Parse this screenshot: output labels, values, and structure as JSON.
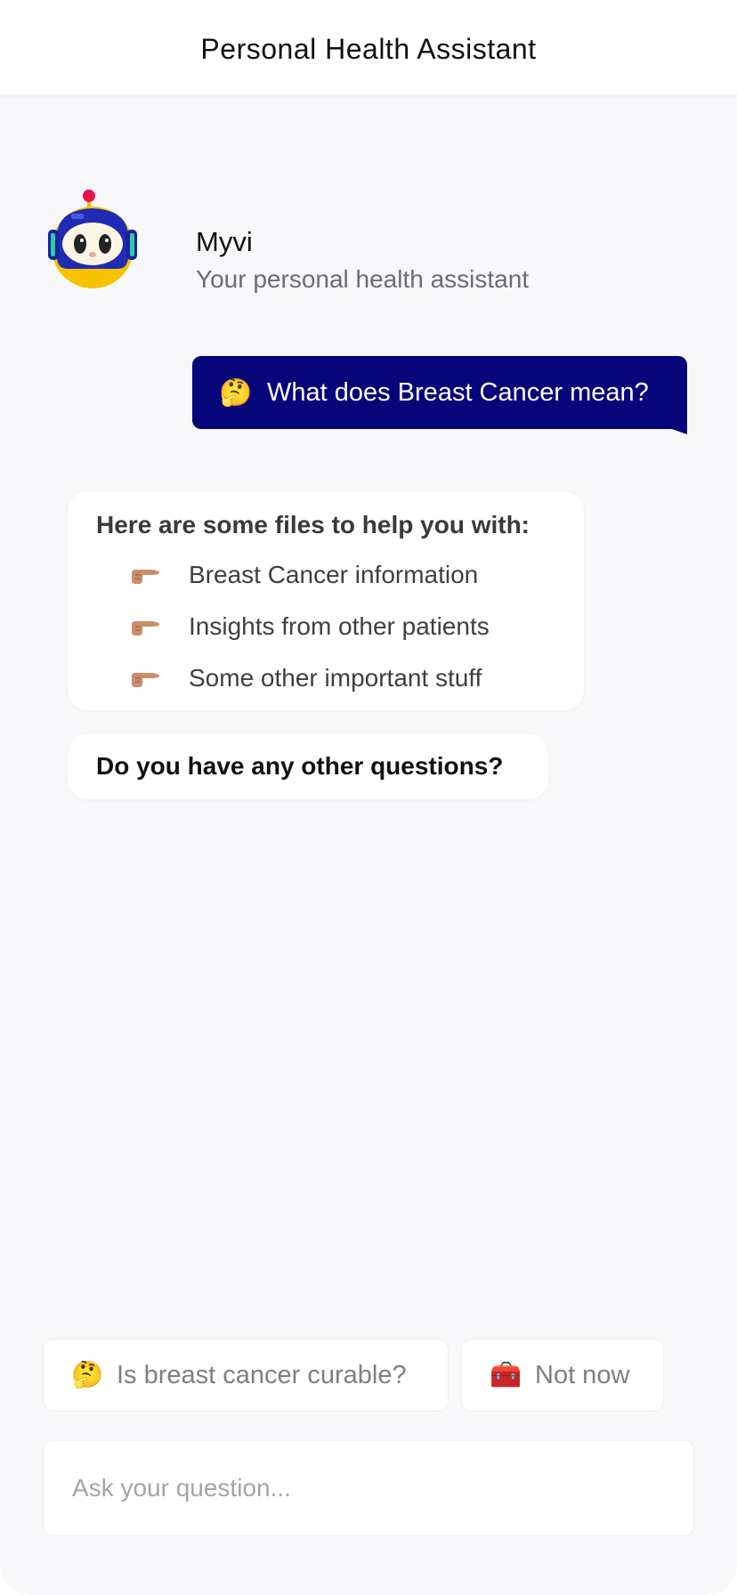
{
  "header": {
    "title": "Personal Health Assistant"
  },
  "bot": {
    "name": "Myvi",
    "subtitle": "Your personal health assistant",
    "avatar_icon": "robot-avatar-icon"
  },
  "conversation": {
    "user_message": {
      "emoji": "🤔",
      "text": "What does Breast Cancer mean?"
    },
    "files_card": {
      "title": "Here are some files to help you with:",
      "items": [
        {
          "icon": "pointing-hand-icon",
          "label": "Breast Cancer information"
        },
        {
          "icon": "pointing-hand-icon",
          "label": "Insights from other patients"
        },
        {
          "icon": "pointing-hand-icon",
          "label": "Some other important stuff"
        }
      ]
    },
    "follow_up": "Do you have any other questions?"
  },
  "suggestions": [
    {
      "emoji": "🤔",
      "label": "Is breast cancer curable?"
    },
    {
      "emoji": "🧰",
      "label": "Not now"
    }
  ],
  "input": {
    "placeholder": "Ask your question...",
    "value": ""
  },
  "colors": {
    "user_bubble": "#06057a",
    "background": "#f8f8fa",
    "avatar_yellow": "#f7c300",
    "avatar_blue": "#1f2bb3"
  }
}
